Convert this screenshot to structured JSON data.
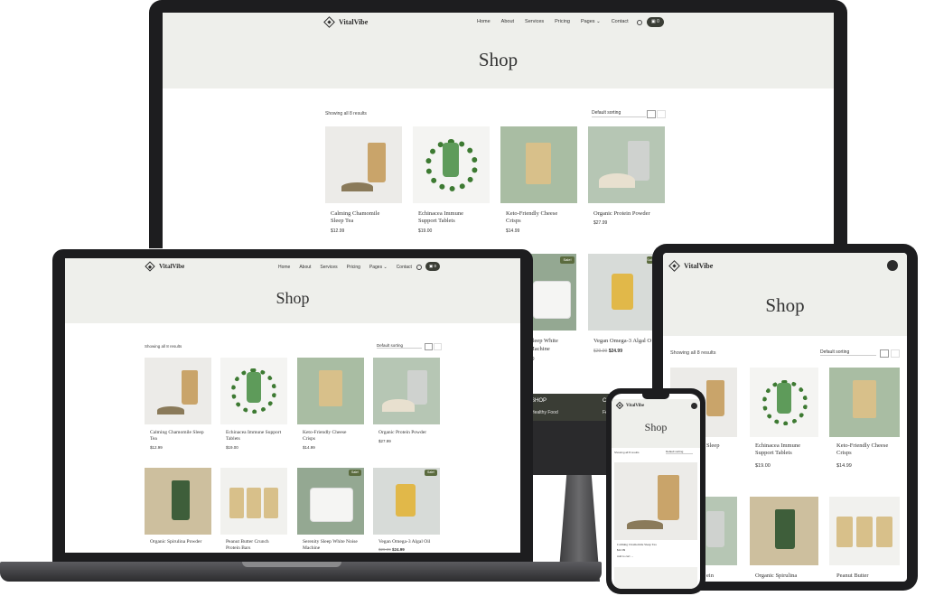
{
  "brand": "VitalVibe",
  "nav": {
    "home": "Home",
    "about": "About",
    "services": "Services",
    "pricing": "Pricing",
    "pages": "Pages",
    "contact": "Contact",
    "cart_count": "0"
  },
  "page_title": "Shop",
  "results": "Showing all 8 results",
  "sorting": "Default sorting",
  "sale_badge": "Sale!",
  "add_to_cart": "Add to cart",
  "footer_shop": "SHOP",
  "footer_item": "Healthy Food",
  "footer_c": "C",
  "footer_fa": "FA",
  "products": [
    {
      "name": "Calming Chamomile Sleep Tea",
      "price": "$12.99"
    },
    {
      "name": "Echinacea Immune Support Tablets",
      "price": "$19.00"
    },
    {
      "name": "Keto-Friendly Cheese Crisps",
      "price": "$14.99"
    },
    {
      "name": "Organic Protein Powder",
      "price": "$27.99"
    },
    {
      "name": "Organic Spirulina Powder",
      "price": ""
    },
    {
      "name": "Peanut Butter Crunch Protein Bars",
      "price": ""
    },
    {
      "name": "Serenity Sleep White Noise Machine",
      "price": ""
    },
    {
      "name": "Vegan Omega-3 Algal Oil",
      "price": "$24.99",
      "old_price": "$29.99"
    }
  ],
  "partial": {
    "sleep_white": "Sleep White",
    "machine": "Machine",
    "price_99": "99",
    "vegan_omega": "Vegan Omega-3 Algal O",
    "vegan_old": "$29.99",
    "vegan_new": "$24.99",
    "sleep": "Sleep",
    "ein": "ein",
    "organic_spirulina": "Organic Spirulina",
    "peanut_butter": "Peanut Butter"
  },
  "colors": {
    "header_bg": "#eeefeb",
    "dark": "#2b2b2b",
    "sale": "#5b6b3e",
    "cart": "#3a3d35"
  }
}
